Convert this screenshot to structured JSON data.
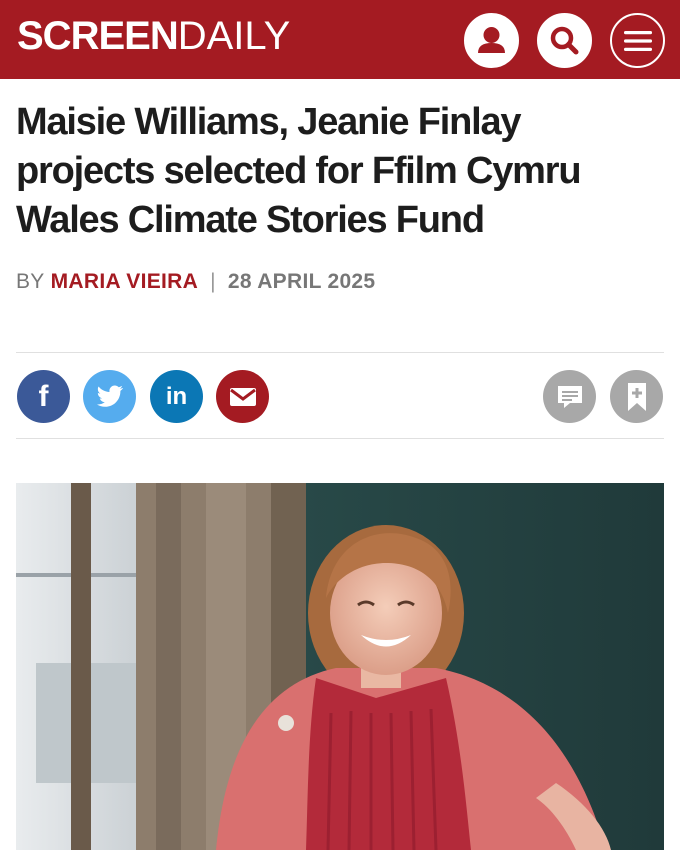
{
  "header": {
    "logo_bold": "SCREEN",
    "logo_light": "DAILY",
    "icons": [
      "user-icon",
      "search-icon",
      "menu-icon"
    ],
    "brand_color": "#a41b22"
  },
  "article": {
    "headline": "Maisie Williams, Jeanie Finlay projects selected for Ffilm Cymru Wales Climate Stories Fund",
    "by_label": "BY",
    "author": "MARIA VIEIRA",
    "separator": "|",
    "date": "28 APRIL 2025"
  },
  "share": {
    "facebook_glyph": "f",
    "linkedin_glyph": "in",
    "icons": [
      "facebook-icon",
      "twitter-icon",
      "linkedin-icon",
      "email-icon",
      "comment-icon",
      "bookmark-icon"
    ]
  }
}
